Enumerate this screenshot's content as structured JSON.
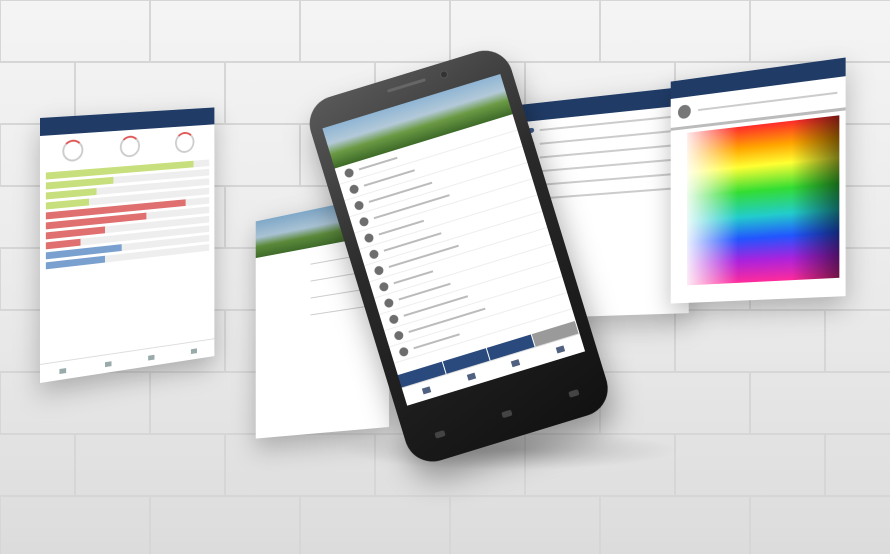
{
  "scene": {
    "description_colors": {
      "app_bar": "#1f3b66",
      "accent_red": "#e07070",
      "accent_green": "#c7df7c",
      "accent_blue": "#7aa0d0"
    }
  },
  "stats_screen": {
    "bars": [
      {
        "color": "#c7df7c",
        "level": 0.9
      },
      {
        "color": "#c7df7c",
        "level": 0.4
      },
      {
        "color": "#c7df7c",
        "level": 0.3
      },
      {
        "color": "#c7df7c",
        "level": 0.25
      },
      {
        "color": "#e07070",
        "level": 0.85
      },
      {
        "color": "#e07070",
        "level": 0.6
      },
      {
        "color": "#e07070",
        "level": 0.35
      },
      {
        "color": "#e07070",
        "level": 0.2
      },
      {
        "color": "#7aa0d0",
        "level": 0.45
      },
      {
        "color": "#7aa0d0",
        "level": 0.35
      }
    ]
  },
  "phone_screen": {
    "contacts_count": 12,
    "action_buttons": 4
  }
}
